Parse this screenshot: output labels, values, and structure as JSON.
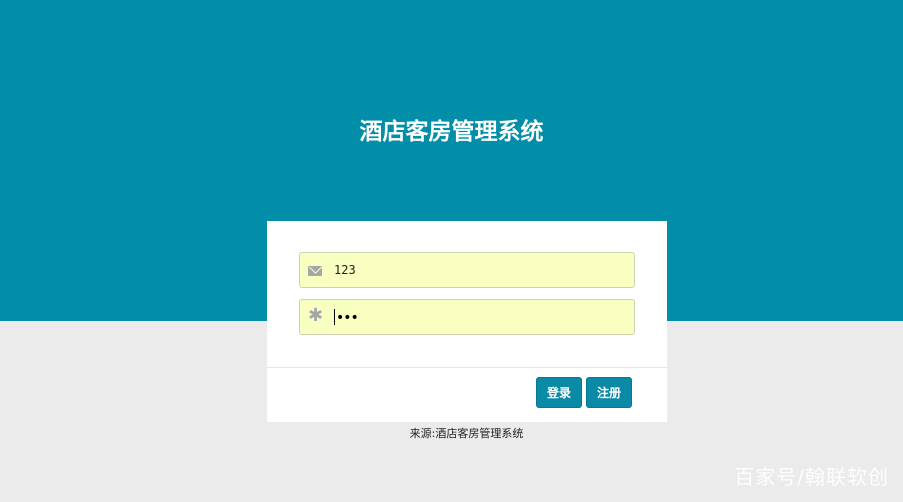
{
  "header": {
    "title": "酒店客房管理系统"
  },
  "login_form": {
    "username": {
      "value": "123",
      "icon": "envelope-icon"
    },
    "password": {
      "masked_value": "•••",
      "icon": "asterisk-icon"
    },
    "buttons": {
      "login_label": "登录",
      "register_label": "注册"
    }
  },
  "footer": {
    "source_text": "来源:酒店客房管理系统"
  },
  "watermark": {
    "text": "百家号/翰联软创"
  },
  "colors": {
    "header_background": "#028ea8",
    "page_background": "#ebebeb",
    "input_background": "#f9ffc0",
    "button_background": "#0b8aa6"
  }
}
